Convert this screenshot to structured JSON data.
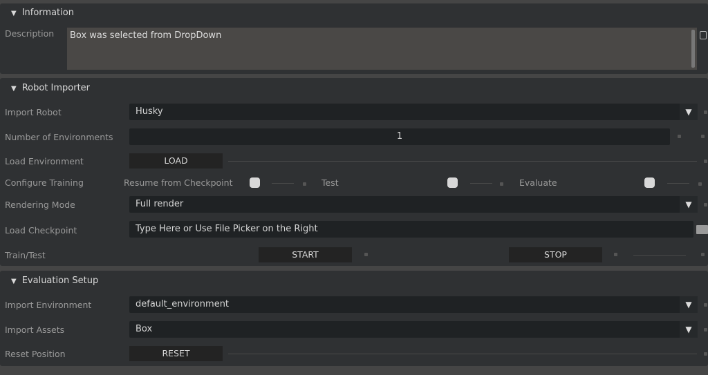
{
  "information": {
    "title": "Information",
    "description_label": "Description",
    "description_value": "Box was selected from DropDown"
  },
  "robot_importer": {
    "title": "Robot Importer",
    "import_robot": {
      "label": "Import Robot",
      "value": "Husky"
    },
    "num_envs": {
      "label": "Number of Environments",
      "value": "1"
    },
    "load_env": {
      "label": "Load Environment",
      "button": "LOAD"
    },
    "configure": {
      "label": "Configure Training",
      "resume": "Resume from Checkpoint",
      "test": "Test",
      "evaluate": "Evaluate"
    },
    "rendering": {
      "label": "Rendering Mode",
      "value": "Full render"
    },
    "checkpoint": {
      "label": "Load Checkpoint",
      "placeholder": "Type Here or Use File Picker on the Right"
    },
    "train_test": {
      "label": "Train/Test",
      "start": "START",
      "stop": "STOP"
    }
  },
  "evaluation": {
    "title": "Evaluation Setup",
    "import_env": {
      "label": "Import Environment",
      "value": "default_environment"
    },
    "import_assets": {
      "label": "Import Assets",
      "value": "Box"
    },
    "reset": {
      "label": "Reset Position",
      "button": "RESET"
    }
  }
}
